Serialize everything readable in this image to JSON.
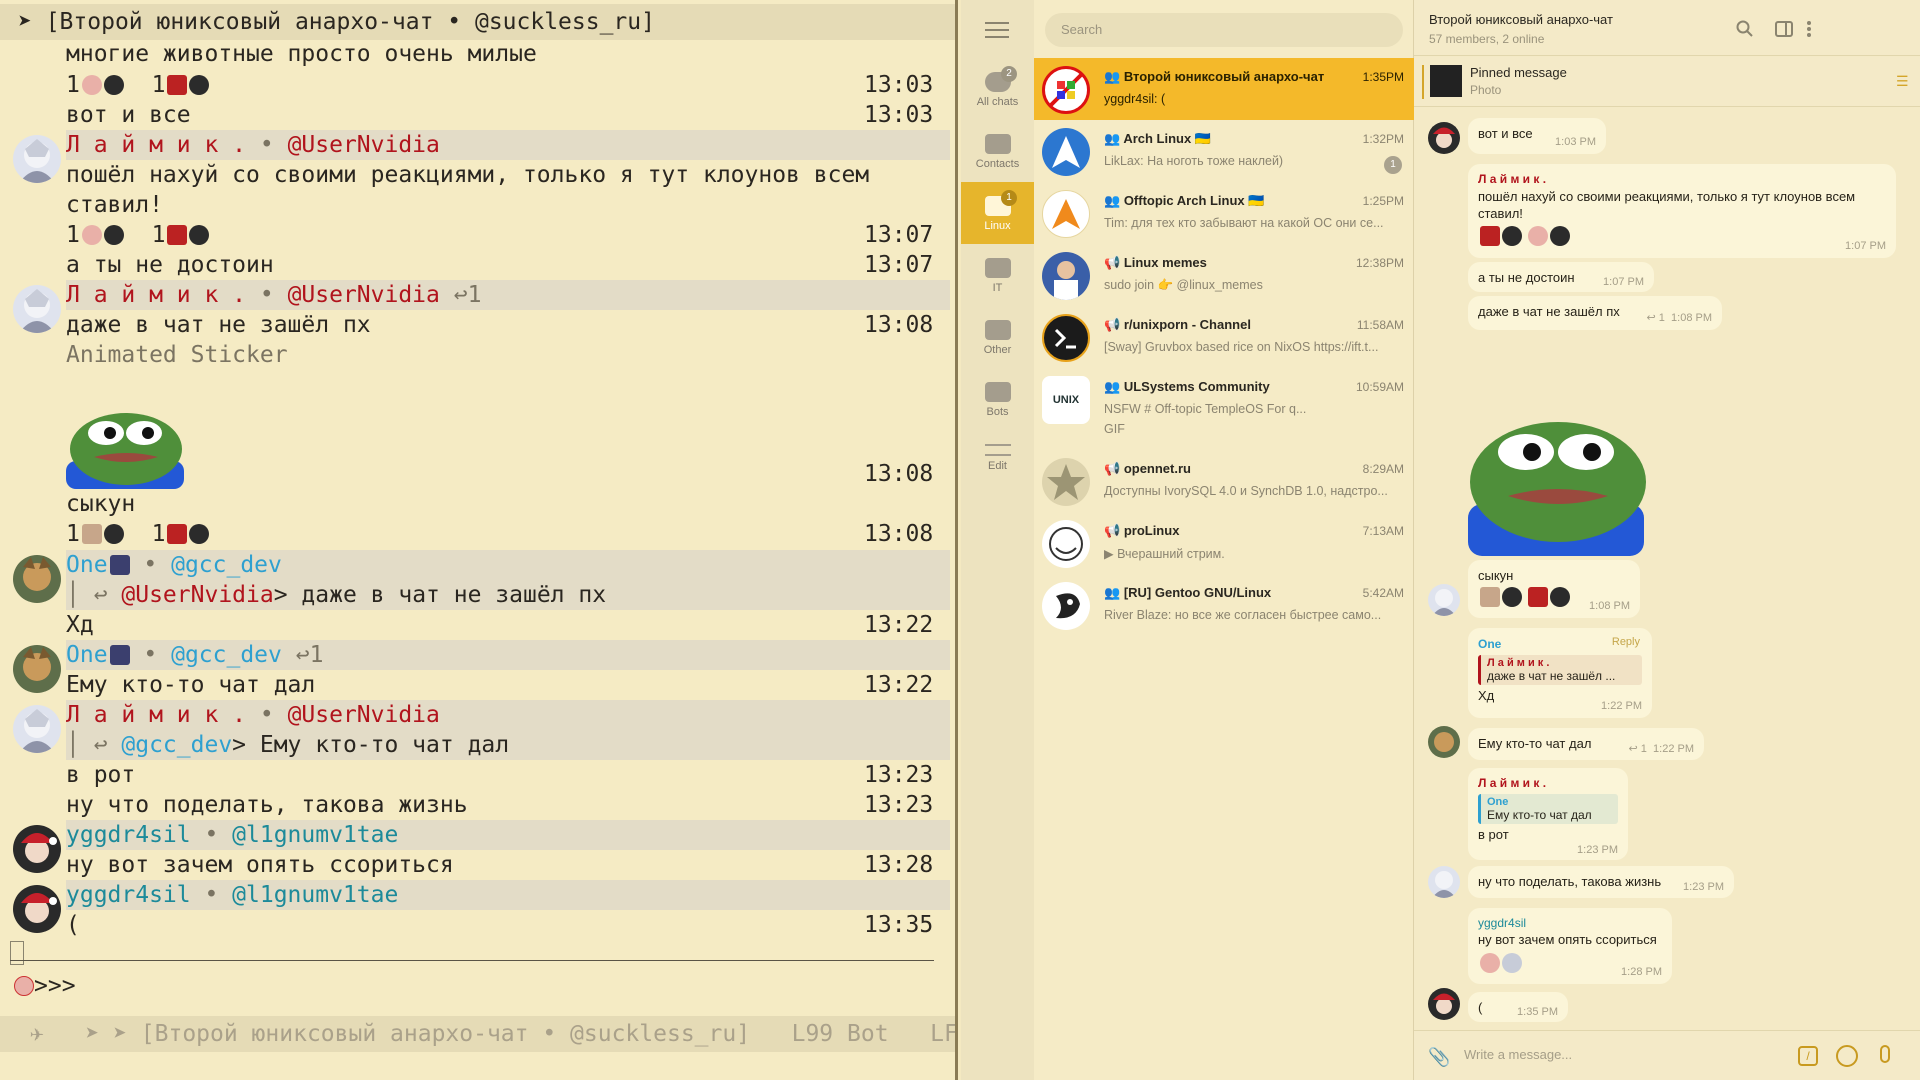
{
  "emacs": {
    "title": "[Второй юниксовый анархо-чат • @suckless_ru]",
    "lines": {
      "l1": "многие животные просто очень милые",
      "r1a": "1",
      "r1b": "1",
      "t1": "13:03",
      "l2": "вот и все",
      "t2": "13:03",
      "h1_nick": "Л а й м и к .",
      "h1_sep": " • ",
      "h1_user": "@UserNvidia",
      "l3": "пошёл нахуй со своими реакциями, только я тут клоунов всем",
      "l3b": "ставил!",
      "r2a": "1",
      "r2b": "1",
      "t3": "13:07",
      "l4": "а ты не достоин",
      "t4": "13:07",
      "h2_nick": "Л а й м и к .",
      "h2_sep": " • ",
      "h2_user": "@UserNvidia",
      "h2_reply": "↩1",
      "l5": "даже в чат не зашёл пх",
      "t5": "13:08",
      "l6": "Animated Sticker",
      "t6": "13:08",
      "l7": "сыкун",
      "r3a": "1",
      "r3b": "1",
      "t7": "13:08",
      "h3_nick": "One",
      "h3_sep": " • ",
      "h3_user": "@gcc_dev",
      "q1_user": "@UserNvidia",
      "q1_text": "> даже в чат не зашёл пх",
      "l8": "Хд",
      "t8": "13:22",
      "h4_nick": "One",
      "h4_sep": " • ",
      "h4_user": "@gcc_dev",
      "h4_reply": "↩1",
      "l9": "Ему кто-то чат дал",
      "t9": "13:22",
      "h5_nick": "Л а й м и к .",
      "h5_sep": " • ",
      "h5_user": "@UserNvidia",
      "q2_user": "@gcc_dev",
      "q2_text": "> Ему кто-то чат дал",
      "l10": "в рот",
      "t10": "13:23",
      "l11": "ну что поделать, такова жизнь",
      "t11": "13:23",
      "h6_nick": "yggdr4sil",
      "h6_sep": " • ",
      "h6_user": "@l1gnumv1tae",
      "l12": "ну вот зачем опять ссориться",
      "t12": "13:28",
      "h7_nick": "yggdr4sil",
      "h7_sep": " • ",
      "h7_user": "@l1gnumv1tae",
      "l13": "(",
      "t13": "13:35"
    },
    "prompt": ">>>",
    "modeline": "[Второй юниксовый анархо-чат • @suckless_ru]",
    "modeline_pos": "L99",
    "modeline_mode": "Bot",
    "modeline_eol": "LF"
  },
  "telegram": {
    "folders": [
      {
        "label": "All chats",
        "badge": "2"
      },
      {
        "label": "Contacts",
        "badge": ""
      },
      {
        "label": "Linux",
        "badge": "1"
      },
      {
        "label": "IT",
        "badge": ""
      },
      {
        "label": "Other",
        "badge": ""
      },
      {
        "label": "Bots",
        "badge": ""
      },
      {
        "label": "Edit",
        "badge": ""
      }
    ],
    "search_placeholder": "Search",
    "chats": [
      {
        "name": "Второй юниксовый анархо-чат",
        "time": "1:35PM",
        "msg": "yggdr4sil: (",
        "badge": ""
      },
      {
        "name": "Arch Linux 🇺🇦",
        "time": "1:32PM",
        "msg": "LikLax: На ноготь тоже наклей)",
        "badge": "1"
      },
      {
        "name": "Offtopic Arch Linux 🇺🇦",
        "time": "1:25PM",
        "msg": "Tim: для тех кто забывают на какой ОС они се...",
        "badge": ""
      },
      {
        "name": "Linux memes",
        "time": "12:38PM",
        "msg": "sudo join 👉 @linux_memes",
        "badge": ""
      },
      {
        "name": "r/unixporn - Channel",
        "time": "11:58AM",
        "msg": "[Sway] Gruvbox based rice on NixOS https://ift.t...",
        "badge": ""
      },
      {
        "name": "ULSystems Community",
        "time": "10:59AM",
        "msg": "NSFW  # Off-topic  TempleOS  For q...",
        "msg2": "GIF",
        "badge": ""
      },
      {
        "name": "opennet.ru",
        "time": "8:29AM",
        "msg": "Доступны IvorySQL 4.0 и SynchDB 1.0, надстро...",
        "badge": ""
      },
      {
        "name": "proLinux",
        "time": "7:13AM",
        "msg": "Вчерашний стрим.",
        "badge": ""
      },
      {
        "name": "[RU] Gentoo GNU/Linux",
        "time": "5:42AM",
        "msg": "River Blaze: но все же согласен быстрее само...",
        "badge": ""
      }
    ],
    "conversation": {
      "title": "Второй юниксовый анархо-чат",
      "subtitle": "57 members, 2 online",
      "pinned_title": "Pinned message",
      "pinned_sub": "Photo",
      "m1_text": "вот и все",
      "m1_time": "1:03 PM",
      "m2_name": "Л а й м и к .",
      "m2_text": "пошёл нахуй со своими реакциями, только я тут клоунов всем ставил!",
      "m2_time": "1:07 PM",
      "m3_text": "а ты не достоин",
      "m3_time": "1:07 PM",
      "m4_text": "даже в чат не зашёл пх",
      "m4_reply": "1",
      "m4_time": "1:08 PM",
      "m5_text": "сыкун",
      "m5_time": "1:08 PM",
      "m6_name": "One",
      "m6_action": "Reply",
      "m6_q_name": "Л а й м и к .",
      "m6_q_text": "даже в чат не зашёл ...",
      "m6_text": "Хд",
      "m6_time": "1:22 PM",
      "m7_text": "Ему кто-то чат дал",
      "m7_reply": "1",
      "m7_time": "1:22 PM",
      "m8_name": "Л а й м и к .",
      "m8_q_name": "One",
      "m8_q_text": "Ему кто-то чат дал",
      "m8_text": "в рот",
      "m8_time": "1:23 PM",
      "m9_text": "ну что поделать, такова жизнь",
      "m9_time": "1:23 PM",
      "m10_name": "yggdr4sil",
      "m10_text": "ну вот зачем опять ссориться",
      "m10_time": "1:28 PM",
      "m11_text": "(",
      "m11_time": "1:35 PM",
      "composer_placeholder": "Write a message..."
    }
  }
}
